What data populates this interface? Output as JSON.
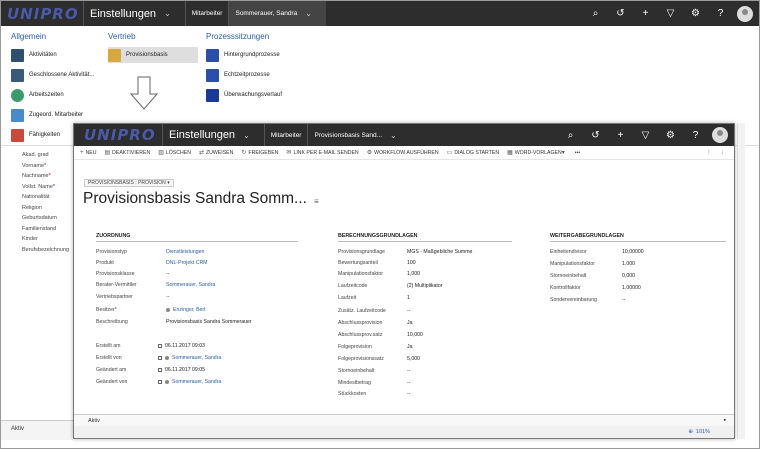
{
  "back": {
    "logo": "UNIPRO",
    "title": "Einstellungen",
    "crumbs": [
      "Mitarbeiter",
      "Sommerauer, Sandra"
    ],
    "menu": {
      "allgemein": {
        "heading": "Allgemein",
        "items": [
          "Aktivitäten",
          "Geschlossene Aktivität...",
          "Arbeitszeiten",
          "Zugeord. Mitarbeiter",
          "Fähigkeiten"
        ]
      },
      "vertrieb": {
        "heading": "Vertrieb",
        "items": [
          "Provisionsbasis"
        ]
      },
      "prozess": {
        "heading": "Prozesssitzungen",
        "items": [
          "Hintergrundprozesse",
          "Echtzeitprozesse",
          "Überwachungsverlauf"
        ]
      }
    },
    "left_fields": [
      "Akad. grad",
      "Vorname",
      "Nachname",
      "Vollst. Name",
      "Nationalität",
      "Religion",
      "Geburtsdatum",
      "Familienstand",
      "Kinder",
      "Berufsbezeichnung"
    ],
    "footer_status": "Aktiv"
  },
  "front": {
    "logo": "UNIPRO",
    "title": "Einstellungen",
    "crumbs": [
      "Mitarbeiter",
      "Provisionsbasis Sand..."
    ],
    "commands": [
      "NEU",
      "DEAKTIVIEREN",
      "LÖSCHEN",
      "ZUWEISEN",
      "FREIGEBEN",
      "LINK PER E-MAIL SENDEN",
      "WORKFLOW AUSFÜHREN",
      "DIALOG STARTEN",
      "WORD-VORLAGEN",
      "•••"
    ],
    "form_label": "PROVISIONSBASIS : PROVISION",
    "form_title": "Provisionsbasis Sandra Somm...",
    "sections": {
      "zuordnung": {
        "heading": "ZUORDNUNG",
        "rows": [
          {
            "k": "Provisionstyp",
            "v": "Dienstleistungen",
            "link": true
          },
          {
            "k": "Produkt",
            "v": "DNL-Projekt CRM",
            "link": true
          },
          {
            "k": "Provisionsklasse",
            "v": "--",
            "link": false
          },
          {
            "k": "Berater-Vermittler",
            "v": "Sommerauer, Sandra",
            "link": true
          },
          {
            "k": "Vertriebspartner",
            "v": "--",
            "link": false
          },
          {
            "k": "Besitzer",
            "v": "Enzinger, Bert",
            "link": true
          },
          {
            "k": "Beschreibung",
            "v": "Provisionsbasis Sandra Sommerauer",
            "link": false
          }
        ],
        "meta": [
          {
            "k": "Erstellt am",
            "v": "06.11.2017  09:03",
            "link": false
          },
          {
            "k": "Erstellt von",
            "v": "Sommerauer, Sandra",
            "link": true
          },
          {
            "k": "Geändert am",
            "v": "06.11.2017  09:05",
            "link": false
          },
          {
            "k": "Geändert von",
            "v": "Sommerauer, Sandra",
            "link": true
          }
        ]
      },
      "berechnung": {
        "heading": "BERECHNUNGSGRUNDLAGEN",
        "rows": [
          {
            "k": "Provisionsgrundlage",
            "v": "MGS - Maßgebliche Summe"
          },
          {
            "k": "Bewertungsanteil",
            "v": "100"
          },
          {
            "k": "Manipulationsfaktor",
            "v": "1,000"
          },
          {
            "k": "Laufzeitcode",
            "v": "(2) Multiplikator"
          },
          {
            "k": "Laufzeit",
            "v": "1"
          },
          {
            "k": "Zusätz. Laufzeitcode",
            "v": "--"
          },
          {
            "k": "Abschlussprovision",
            "v": "Ja"
          },
          {
            "k": "Abschlussprov.satz",
            "v": "10,000"
          },
          {
            "k": "Folgeprovision",
            "v": "Ja"
          },
          {
            "k": "Folgeprovisionssatz",
            "v": "5,000"
          },
          {
            "k": "Stornoeinbehalt",
            "v": "--"
          },
          {
            "k": "Mindestbetrag",
            "v": "--"
          },
          {
            "k": "Stückkosten",
            "v": "--"
          }
        ]
      },
      "weitergabe": {
        "heading": "WEITERGABEGRUNDLAGEN",
        "rows": [
          {
            "k": "Einheitendivisor",
            "v": "10,00000"
          },
          {
            "k": "Manipulationsfaktor",
            "v": "1,000"
          },
          {
            "k": "Stornoeinbehalt",
            "v": "0,000"
          },
          {
            "k": "Kontrollfaktor",
            "v": "1,00000"
          },
          {
            "k": "Sondervereinbarung",
            "v": "--"
          }
        ]
      }
    },
    "footer_status": "Aktiv",
    "zoom": "101%"
  }
}
